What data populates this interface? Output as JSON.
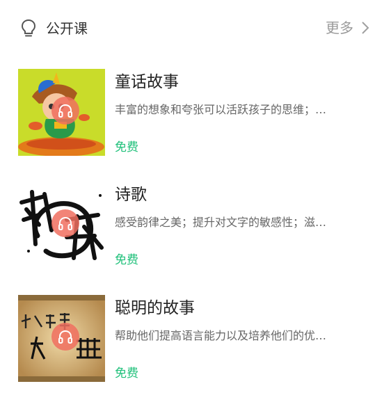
{
  "section": {
    "title": "公开课",
    "more_label": "更多",
    "icon": "lightbulb-icon"
  },
  "courses": [
    {
      "title": "童话故事",
      "description": "丰富的想象和夸张可以活跃孩子的思维；…",
      "price": "免费",
      "thumbnail": "fairy-tale-character-cover"
    },
    {
      "title": "诗歌",
      "description": "感受韵律之美；提升对文字的敏感性；滋…",
      "price": "免费",
      "thumbnail": "poetry-calligraphy-cover"
    },
    {
      "title": "聪明的故事",
      "description": "帮助他们提高语言能力以及培养他们的优…",
      "price": "免费",
      "thumbnail": "small-story-big-truth-cover"
    }
  ],
  "colors": {
    "price": "#1fc07a",
    "play_badge": "#f06e5f",
    "title": "#222222",
    "muted": "#9a9a9a"
  }
}
